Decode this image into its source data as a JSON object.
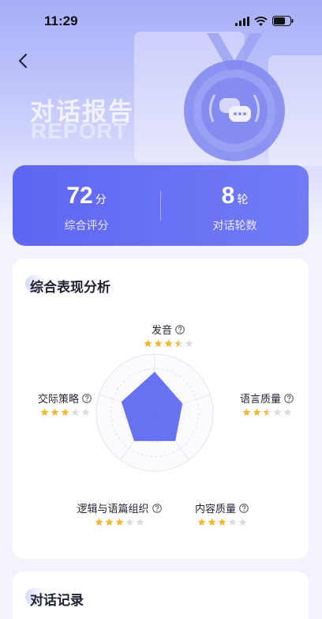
{
  "status_bar": {
    "time": "11:29"
  },
  "header": {
    "title": "对话报告",
    "subtitle": "REPORT"
  },
  "summary": {
    "score_value": "72",
    "score_unit": "分",
    "score_label": "综合评分",
    "rounds_value": "8",
    "rounds_unit": "轮",
    "rounds_label": "对话轮数"
  },
  "analysis": {
    "title": "综合表现分析",
    "dimensions": [
      {
        "label": "发音",
        "rating": 3.5,
        "max": 5
      },
      {
        "label": "语言质量",
        "rating": 2.5,
        "max": 5
      },
      {
        "label": "内容质量",
        "rating": 3,
        "max": 5
      },
      {
        "label": "逻辑与语篇组织",
        "rating": 3,
        "max": 5
      },
      {
        "label": "交际策略",
        "rating": 3,
        "max": 5
      }
    ]
  },
  "records": {
    "title": "对话记录"
  },
  "colors": {
    "primary": "#5e66f2",
    "star": "#f5b731",
    "star_empty": "#dcdde3",
    "radar_fill": "#5e6af1"
  }
}
